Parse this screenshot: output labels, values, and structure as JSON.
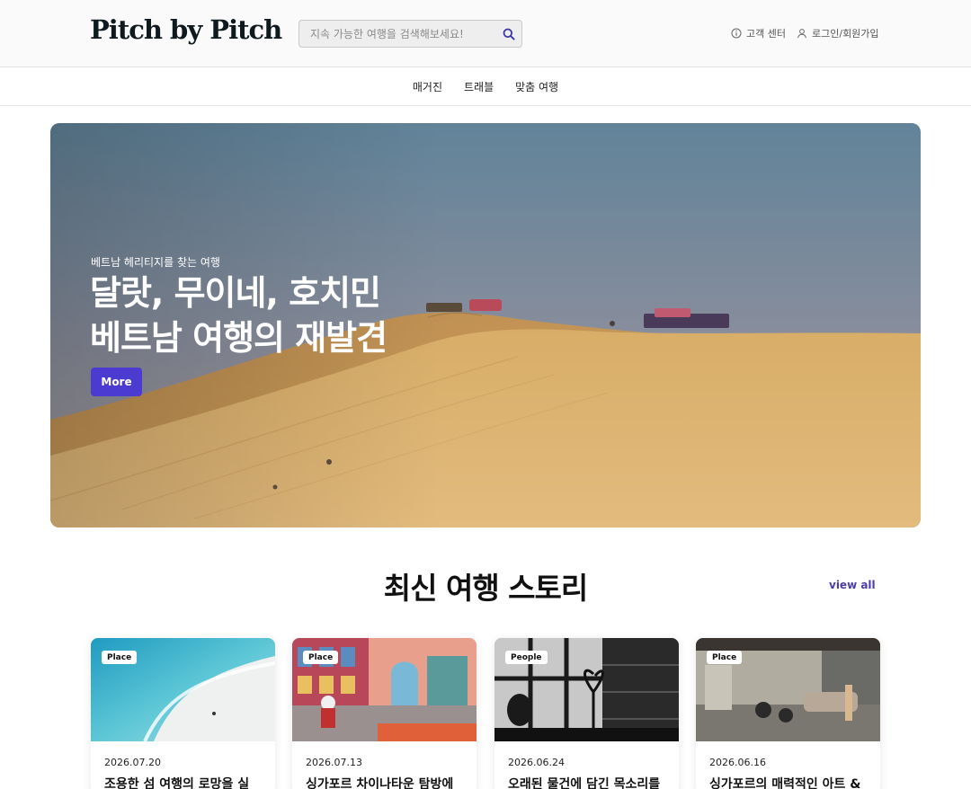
{
  "header": {
    "logo": "Pitch by Pitch",
    "search": {
      "placeholder": "지속 가능한 여행을 검색해보세요!",
      "value": ""
    },
    "customer_center": "고객 센터",
    "login": "로그인/회원가입"
  },
  "nav": {
    "items": [
      "매거진",
      "트래블",
      "맞춤 여행"
    ]
  },
  "hero": {
    "subtitle": "베트남 헤리티지를 찾는 여행",
    "title_line1": "달랏, 무이네, 호치민",
    "title_line2": "베트남 여행의 재발견",
    "button": "More"
  },
  "section": {
    "title": "최신 여행 스토리",
    "view_all": "view all"
  },
  "cards": [
    {
      "badge": "Place",
      "date": "2026.07.20",
      "title": "조용한 섬 여행의 로망을 실"
    },
    {
      "badge": "Place",
      "date": "2026.07.13",
      "title": "싱가포르 차이나타운 탐방에"
    },
    {
      "badge": "People",
      "date": "2026.06.24",
      "title": "오래된 물건에 담긴 목소리를"
    },
    {
      "badge": "Place",
      "date": "2026.06.16",
      "title": "싱가포르의 매력적인 아트 &"
    }
  ],
  "colors": {
    "accent": "#4b3bd1",
    "view_all": "#4a3fa6",
    "logo": "#0f1a1f"
  }
}
